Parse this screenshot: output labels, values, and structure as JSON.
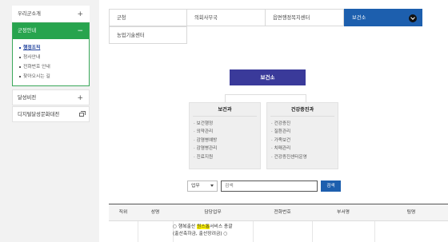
{
  "sidebar": {
    "item_intro": "우리군소개",
    "group_title": "군정안내",
    "sub_items": [
      {
        "label": "행정조직",
        "active": true
      },
      {
        "label": "청사안내"
      },
      {
        "label": "전화번호 안내"
      },
      {
        "label": "찾아오시는 길"
      }
    ],
    "item_vision": "달성비전",
    "item_digital": "디지털달성문화대전"
  },
  "tabs": {
    "row1": [
      "군청",
      "의회사무국",
      "읍면행정복지센터",
      "보건소"
    ],
    "row2": [
      "농업기술센터"
    ],
    "active": "보건소"
  },
  "org": {
    "top": "보건소",
    "left": {
      "title": "보건과",
      "items": [
        "보건행정",
        "의약관리",
        "감염병예방",
        "감염병관리",
        "진료지원"
      ]
    },
    "right": {
      "title": "건강증진과",
      "items": [
        "건강증진",
        "질환관리",
        "가족보건",
        "치매관리",
        "건강증진센터운영"
      ]
    }
  },
  "search": {
    "select_value": "업무",
    "placeholder": "검색",
    "button": "검색"
  },
  "table": {
    "headers": [
      "직위",
      "성명",
      "담당업무",
      "전화번호",
      "부서명",
      "팀명"
    ],
    "row1": {
      "duty_prefix": "○ 행복출산 ",
      "duty_highlight": "원스톱",
      "duty_suffix": "서비스 총괄",
      "duty_line2": "(출산축하금, 출산장려금) ○"
    }
  }
}
